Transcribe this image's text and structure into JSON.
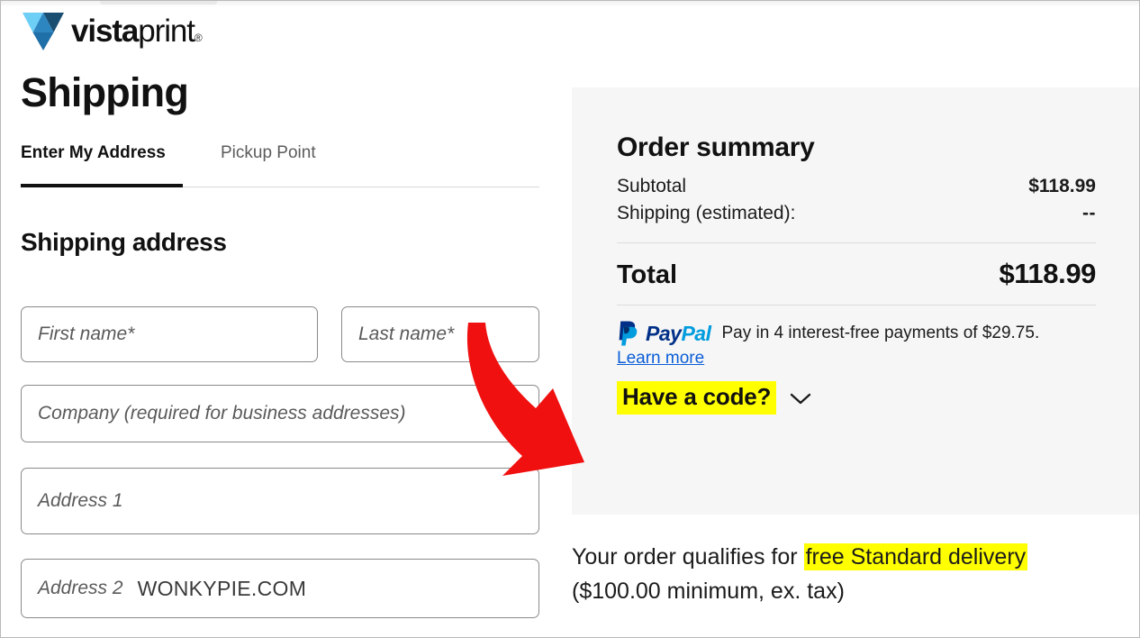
{
  "brand": {
    "logo_icon": "vistaprint-v-logo-icon",
    "name_bold": "vista",
    "name_light": "print",
    "registered_mark": "®"
  },
  "page": {
    "title": "Shipping"
  },
  "tabs": [
    {
      "label": "Enter My Address",
      "active": true
    },
    {
      "label": "Pickup Point",
      "active": false
    }
  ],
  "form": {
    "section_title": "Shipping address",
    "fields": [
      {
        "name": "first-name",
        "placeholder": "First name*",
        "value": ""
      },
      {
        "name": "last-name",
        "placeholder": "Last name*",
        "value": ""
      },
      {
        "name": "company",
        "placeholder": "Company (required for business addresses)",
        "value": ""
      },
      {
        "name": "address-1",
        "placeholder": "Address 1",
        "value": ""
      },
      {
        "name": "address-2",
        "placeholder": "Address 2",
        "value": ""
      }
    ]
  },
  "watermark": {
    "text": "WONKYPIE.COM"
  },
  "summary": {
    "title": "Order summary",
    "rows": [
      {
        "label": "Subtotal",
        "value": "$118.99"
      },
      {
        "label": "Shipping (estimated):",
        "value": "--"
      }
    ],
    "total_label": "Total",
    "total_value": "$118.99"
  },
  "paypal": {
    "mark_icon": "paypal-logo-icon",
    "word_dark": "Pay",
    "word_light": "Pal",
    "message": "Pay in 4 interest-free payments of $29.75.",
    "link": "Learn more",
    "color_dark": "#003087",
    "color_light": "#009cde"
  },
  "promo": {
    "label": "Have a code?",
    "chevron_icon": "chevron-down-icon",
    "highlight_color": "#ffff00"
  },
  "order_note": {
    "prefix": "Your order qualifies for ",
    "highlight": "free Standard delivery",
    "suffix": "($100.00 minimum, ex. tax)"
  },
  "annotation": {
    "arrow_icon": "red-curved-arrow-icon",
    "color": "#f01010"
  }
}
